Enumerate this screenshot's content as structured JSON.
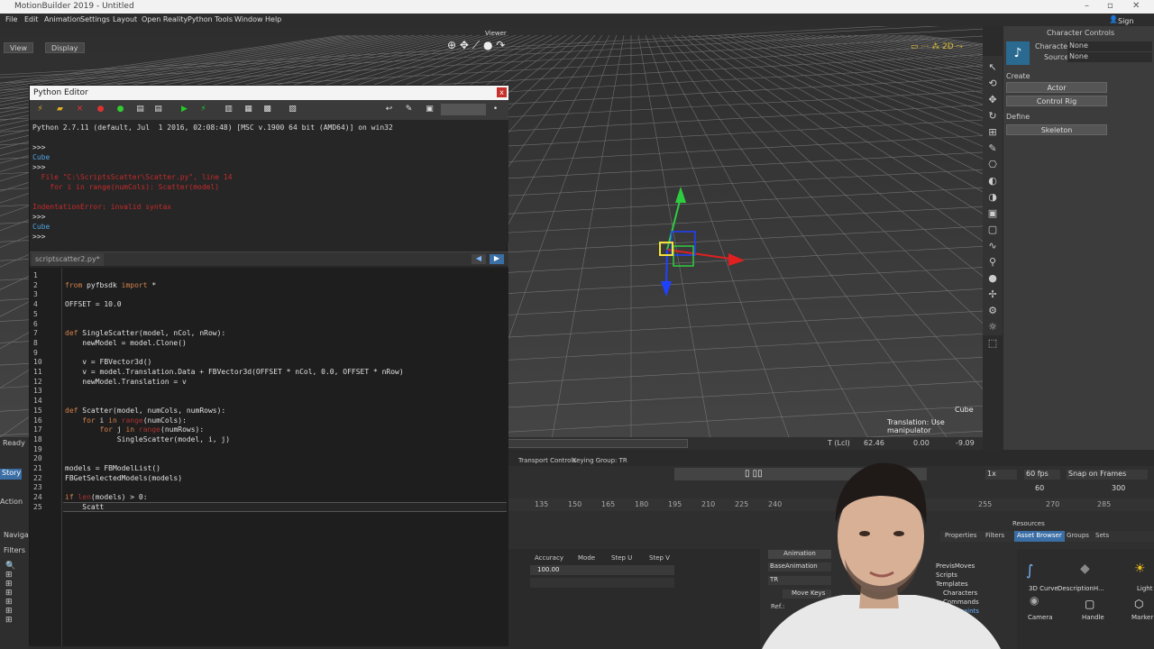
{
  "app": {
    "title": "MotionBuilder 2019 - Untitled",
    "signin": "Sign In",
    "menu": [
      "File",
      "Edit",
      "Animation",
      "Settings",
      "Layout",
      "Open Reality",
      "Python Tools",
      "Window",
      "Help"
    ]
  },
  "viewer": {
    "label": "Viewer",
    "view_btn": "View",
    "display_btn": "Display",
    "object_name": "Cube",
    "status": "Translation: Use manipulator",
    "coord_label": "T (Lcl)",
    "x": "62.46",
    "y": "0.00",
    "z": "-9.09",
    "status_left": "Ready"
  },
  "character_controls": {
    "title": "Character Controls",
    "character_label": "Character:",
    "character_value": "None",
    "source_label": "Source:",
    "source_value": "None",
    "create_label": "Create",
    "actor_btn": "Actor",
    "control_rig_btn": "Control Rig",
    "define_label": "Define",
    "skeleton_btn": "Skeleton"
  },
  "python_editor": {
    "title": "Python Editor",
    "close": "x",
    "output": [
      {
        "text": "Python 2.7.11 (default, Jul  1 2016, 02:08:48) [MSC v.1900 64 bit (AMD64)] on win32",
        "color": "white"
      },
      {
        "text": "",
        "color": "white"
      },
      {
        "text": ">>>",
        "color": "white"
      },
      {
        "text": "Cube",
        "color": "blue"
      },
      {
        "text": ">>>",
        "color": "white"
      },
      {
        "text": "  File \"C:\\ScriptsScatter\\Scatter.py\", line 14",
        "color": "red"
      },
      {
        "text": "    for i in range(numCols): Scatter(model)",
        "color": "red"
      },
      {
        "text": "",
        "color": "white"
      },
      {
        "text": "IndentationError: invalid syntax",
        "color": "red"
      },
      {
        "text": ">>>",
        "color": "white"
      },
      {
        "text": "Cube",
        "color": "blue"
      },
      {
        "text": ">>>",
        "color": "white"
      }
    ],
    "tab_name": "scriptscatter2.py*",
    "code": [
      "",
      "from pyfbsdk import *",
      "",
      "OFFSET = 10.0",
      "",
      "",
      "def SingleScatter(model, nCol, nRow):",
      "    newModel = model.Clone()",
      "",
      "    v = FBVector3d()",
      "    v = model.Translation.Data + FBVector3d(OFFSET * nCol, 0.0, OFFSET * nRow)",
      "    newModel.Translation = v",
      "",
      "",
      "def Scatter(model, numCols, numRows):",
      "    for i in range(numCols):",
      "        for j in range(numRows):",
      "            SingleScatter(model, i, j)",
      "",
      "",
      "models = FBModelList()",
      "FBGetSelectedModels(models)",
      "",
      "if len(models) > 0:",
      "    Scatt"
    ]
  },
  "transport": {
    "title": "Transport Controls",
    "keying_group": "Keying Group: TR",
    "speed": "1x",
    "fps": "60 fps",
    "snap": "Snap on Frames",
    "start": "60",
    "end": "300",
    "ticks": [
      "135",
      "150",
      "165",
      "180",
      "195",
      "210",
      "225",
      "240",
      "255",
      "270",
      "285"
    ]
  },
  "properties": {
    "columns": [
      "Accuracy",
      "Mode",
      "Step U",
      "Step V"
    ],
    "accuracy": "100.00"
  },
  "key_controls": {
    "tab_animation": "Animation",
    "layer": "BaseAnimation",
    "group": "TR",
    "move_keys": "Move Keys",
    "ref": "Ref.:"
  },
  "resources": {
    "title": "Resources",
    "tabs": [
      "Properties",
      "Filters",
      "Asset Browser",
      "Groups",
      "Sets"
    ],
    "tree": [
      "PrevisMoves",
      "Scripts",
      "Templates",
      "Characters",
      "Commands",
      "Constraints"
    ],
    "assets": [
      "3D Curve",
      "DescriptionH...",
      "Light",
      "Camera",
      "Handle",
      "Marker"
    ]
  },
  "left_panels": {
    "story": "Story",
    "navigator": "Navigat",
    "filters": "Filters",
    "action": "Action"
  }
}
